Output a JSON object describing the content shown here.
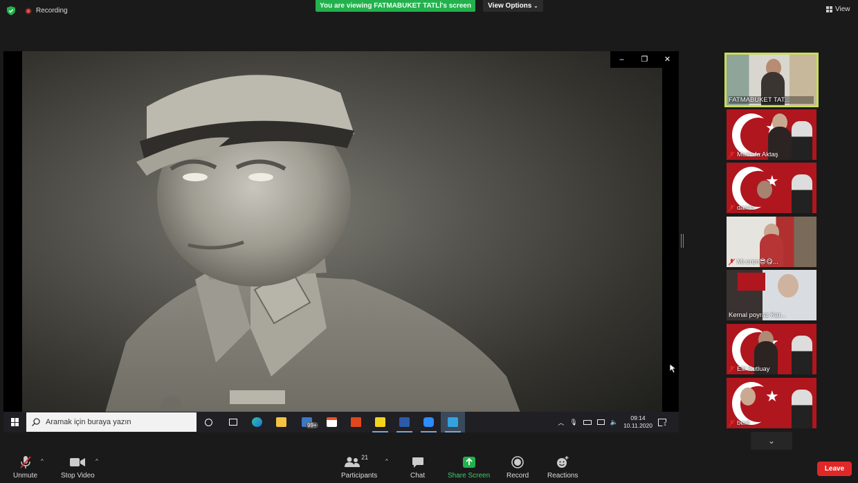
{
  "top_bar": {
    "recording_label": "Recording",
    "viewing_banner": "You are viewing FATMABUKET TATLİ's screen",
    "view_options_label": "View Options",
    "view_label": "View"
  },
  "shared_window": {
    "controls": {
      "minimize": "–",
      "restore": "❐",
      "close": "✕"
    }
  },
  "taskbar": {
    "search_placeholder": "Aramak için buraya yazın",
    "mail_badge": "99+",
    "clock_time": "09:14",
    "clock_date": "10.11.2020",
    "notification_count": "1"
  },
  "participants": [
    {
      "name": "FATMABUKET TAT...",
      "active": true
    },
    {
      "name": "Mustafa Aktaş"
    },
    {
      "name": "damla"
    },
    {
      "name": "Mr.eren😎😋..."
    },
    {
      "name": "Kemal poyraz Kar..."
    },
    {
      "name": "Elif Kutluay"
    },
    {
      "name": "berit"
    }
  ],
  "controls": {
    "unmute": "Unmute",
    "stop_video": "Stop Video",
    "participants": "Participants",
    "participants_count": "21",
    "chat": "Chat",
    "share_screen": "Share Screen",
    "record": "Record",
    "reactions": "Reactions",
    "leave": "Leave"
  },
  "colors": {
    "banner_green": "#23b14d",
    "active_thumb_outline": "#c9dc5a",
    "leave_red": "#e02828",
    "share_green": "#23b14d"
  }
}
